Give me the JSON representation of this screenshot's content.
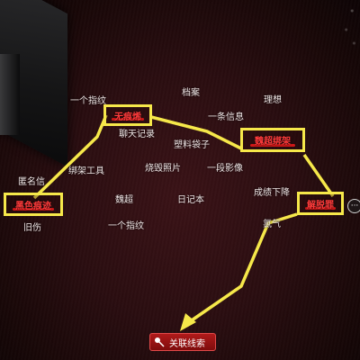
{
  "scene": {
    "words": [
      {
        "id": "yige-zhiwen-top",
        "text": "一个指纹"
      },
      {
        "id": "dangan",
        "text": "档案"
      },
      {
        "id": "lixiang",
        "text": "理想"
      },
      {
        "id": "yitiao-xinxi",
        "text": "一条信息"
      },
      {
        "id": "liaotian-jilu",
        "text": "聊天记录"
      },
      {
        "id": "suliao-daizi",
        "text": "塑料袋子"
      },
      {
        "id": "niming-xin",
        "text": "匿名信"
      },
      {
        "id": "bangjia-gongju",
        "text": "绑架工具"
      },
      {
        "id": "shaohui-zhaopian",
        "text": "烧毁照片"
      },
      {
        "id": "yiduan-yingxiang",
        "text": "一段影像"
      },
      {
        "id": "chengji-xiajiang",
        "text": "成绩下降"
      },
      {
        "id": "weichao",
        "text": "魏超"
      },
      {
        "id": "riji-ben",
        "text": "日记本"
      },
      {
        "id": "jiushang",
        "text": "旧伤"
      },
      {
        "id": "yige-zhiwen-bottom",
        "text": "一个指纹"
      },
      {
        "id": "ranqi",
        "text": "氯气"
      }
    ],
    "selected_clues": [
      {
        "id": "wuheng-shi",
        "text": "无痕烯"
      },
      {
        "id": "weichao-bangjia",
        "text": "魏超绑架"
      },
      {
        "id": "heise-hendi",
        "text": "黑色痕迹"
      },
      {
        "id": "jietuo-zui",
        "text": "解脱罪"
      }
    ],
    "more_button": "···",
    "link_button": "关联线索"
  },
  "colors": {
    "highlight_box": "#f6e84a",
    "clue_text": "#ff3b3b",
    "button_red": "#b01a1a"
  }
}
